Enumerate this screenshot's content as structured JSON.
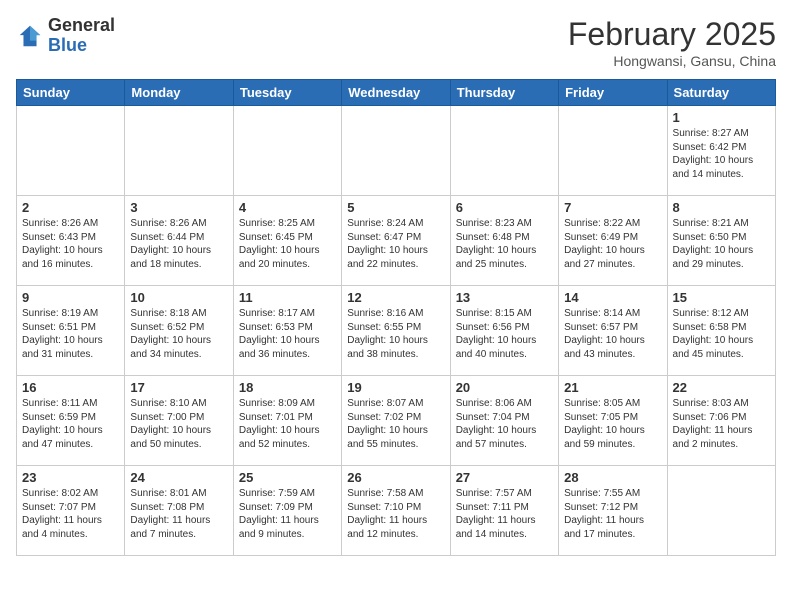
{
  "header": {
    "logo_general": "General",
    "logo_blue": "Blue",
    "month_title": "February 2025",
    "subtitle": "Hongwansi, Gansu, China"
  },
  "days_of_week": [
    "Sunday",
    "Monday",
    "Tuesday",
    "Wednesday",
    "Thursday",
    "Friday",
    "Saturday"
  ],
  "weeks": [
    [
      {
        "day": "",
        "info": ""
      },
      {
        "day": "",
        "info": ""
      },
      {
        "day": "",
        "info": ""
      },
      {
        "day": "",
        "info": ""
      },
      {
        "day": "",
        "info": ""
      },
      {
        "day": "",
        "info": ""
      },
      {
        "day": "1",
        "info": "Sunrise: 8:27 AM\nSunset: 6:42 PM\nDaylight: 10 hours\nand 14 minutes."
      }
    ],
    [
      {
        "day": "2",
        "info": "Sunrise: 8:26 AM\nSunset: 6:43 PM\nDaylight: 10 hours\nand 16 minutes."
      },
      {
        "day": "3",
        "info": "Sunrise: 8:26 AM\nSunset: 6:44 PM\nDaylight: 10 hours\nand 18 minutes."
      },
      {
        "day": "4",
        "info": "Sunrise: 8:25 AM\nSunset: 6:45 PM\nDaylight: 10 hours\nand 20 minutes."
      },
      {
        "day": "5",
        "info": "Sunrise: 8:24 AM\nSunset: 6:47 PM\nDaylight: 10 hours\nand 22 minutes."
      },
      {
        "day": "6",
        "info": "Sunrise: 8:23 AM\nSunset: 6:48 PM\nDaylight: 10 hours\nand 25 minutes."
      },
      {
        "day": "7",
        "info": "Sunrise: 8:22 AM\nSunset: 6:49 PM\nDaylight: 10 hours\nand 27 minutes."
      },
      {
        "day": "8",
        "info": "Sunrise: 8:21 AM\nSunset: 6:50 PM\nDaylight: 10 hours\nand 29 minutes."
      }
    ],
    [
      {
        "day": "9",
        "info": "Sunrise: 8:19 AM\nSunset: 6:51 PM\nDaylight: 10 hours\nand 31 minutes."
      },
      {
        "day": "10",
        "info": "Sunrise: 8:18 AM\nSunset: 6:52 PM\nDaylight: 10 hours\nand 34 minutes."
      },
      {
        "day": "11",
        "info": "Sunrise: 8:17 AM\nSunset: 6:53 PM\nDaylight: 10 hours\nand 36 minutes."
      },
      {
        "day": "12",
        "info": "Sunrise: 8:16 AM\nSunset: 6:55 PM\nDaylight: 10 hours\nand 38 minutes."
      },
      {
        "day": "13",
        "info": "Sunrise: 8:15 AM\nSunset: 6:56 PM\nDaylight: 10 hours\nand 40 minutes."
      },
      {
        "day": "14",
        "info": "Sunrise: 8:14 AM\nSunset: 6:57 PM\nDaylight: 10 hours\nand 43 minutes."
      },
      {
        "day": "15",
        "info": "Sunrise: 8:12 AM\nSunset: 6:58 PM\nDaylight: 10 hours\nand 45 minutes."
      }
    ],
    [
      {
        "day": "16",
        "info": "Sunrise: 8:11 AM\nSunset: 6:59 PM\nDaylight: 10 hours\nand 47 minutes."
      },
      {
        "day": "17",
        "info": "Sunrise: 8:10 AM\nSunset: 7:00 PM\nDaylight: 10 hours\nand 50 minutes."
      },
      {
        "day": "18",
        "info": "Sunrise: 8:09 AM\nSunset: 7:01 PM\nDaylight: 10 hours\nand 52 minutes."
      },
      {
        "day": "19",
        "info": "Sunrise: 8:07 AM\nSunset: 7:02 PM\nDaylight: 10 hours\nand 55 minutes."
      },
      {
        "day": "20",
        "info": "Sunrise: 8:06 AM\nSunset: 7:04 PM\nDaylight: 10 hours\nand 57 minutes."
      },
      {
        "day": "21",
        "info": "Sunrise: 8:05 AM\nSunset: 7:05 PM\nDaylight: 10 hours\nand 59 minutes."
      },
      {
        "day": "22",
        "info": "Sunrise: 8:03 AM\nSunset: 7:06 PM\nDaylight: 11 hours\nand 2 minutes."
      }
    ],
    [
      {
        "day": "23",
        "info": "Sunrise: 8:02 AM\nSunset: 7:07 PM\nDaylight: 11 hours\nand 4 minutes."
      },
      {
        "day": "24",
        "info": "Sunrise: 8:01 AM\nSunset: 7:08 PM\nDaylight: 11 hours\nand 7 minutes."
      },
      {
        "day": "25",
        "info": "Sunrise: 7:59 AM\nSunset: 7:09 PM\nDaylight: 11 hours\nand 9 minutes."
      },
      {
        "day": "26",
        "info": "Sunrise: 7:58 AM\nSunset: 7:10 PM\nDaylight: 11 hours\nand 12 minutes."
      },
      {
        "day": "27",
        "info": "Sunrise: 7:57 AM\nSunset: 7:11 PM\nDaylight: 11 hours\nand 14 minutes."
      },
      {
        "day": "28",
        "info": "Sunrise: 7:55 AM\nSunset: 7:12 PM\nDaylight: 11 hours\nand 17 minutes."
      },
      {
        "day": "",
        "info": ""
      }
    ]
  ]
}
